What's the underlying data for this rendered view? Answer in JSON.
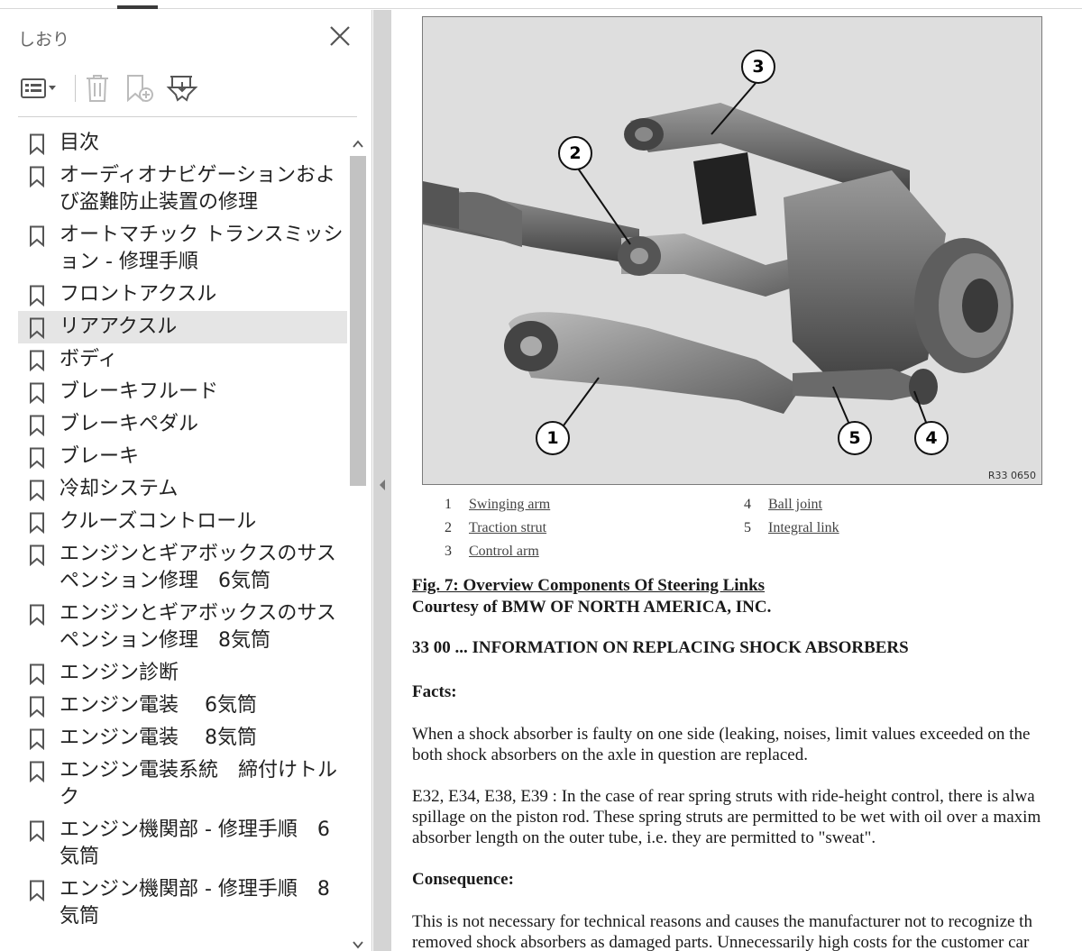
{
  "sidebar": {
    "title": "しおり",
    "close_icon": "close-icon",
    "toolbar": [
      {
        "name": "bookmark-options-menu",
        "icon": "list-options-icon"
      },
      {
        "name": "delete-bookmark-button",
        "icon": "trash-icon"
      },
      {
        "name": "add-bookmark-button",
        "icon": "bookmark-add-icon"
      },
      {
        "name": "expand-bookmark-button",
        "icon": "bookmark-expand-icon"
      }
    ],
    "bookmarks": [
      "目次",
      "オーディオナビゲーションおよび盗難防止装置の修理",
      "オートマチック トランスミッション - 修理手順",
      "フロントアクスル",
      "リアアクスル",
      "ボディ",
      "ブレーキフルード",
      "ブレーキペダル",
      "ブレーキ",
      "冷却システム",
      "クルーズコントロール",
      "エンジンとギアボックスのサスペンション修理　6気筒",
      "エンジンとギアボックスのサスペンション修理　8気筒",
      "エンジン診断",
      "エンジン電装　 6気筒",
      "エンジン電装　 8気筒",
      "エンジン電装系統　締付けトルク",
      "エンジン機関部 - 修理手順　6気筒",
      "エンジン機関部 - 修理手順　8気筒"
    ],
    "selected_index": 4
  },
  "document": {
    "figure_code": "R33 0650",
    "callouts": [
      "1",
      "2",
      "3",
      "4",
      "5"
    ],
    "legend": [
      {
        "num": "1",
        "label": "Swinging arm"
      },
      {
        "num": "2",
        "label": "Traction strut"
      },
      {
        "num": "3",
        "label": "Control arm"
      },
      {
        "num": "4",
        "label": "Ball joint"
      },
      {
        "num": "5",
        "label": "Integral link"
      }
    ],
    "caption": "Fig. 7: Overview Components Of Steering Links",
    "courtesy": "Courtesy of BMW OF NORTH AMERICA, INC.",
    "heading": "33 00 ... INFORMATION ON REPLACING SHOCK ABSORBERS",
    "facts_heading": "Facts:",
    "para1_line1": "When a shock absorber is faulty on one side (leaking, noises, limit values exceeded on the",
    "para1_line2": "both shock absorbers on the axle in question are replaced.",
    "para2_line1": "E32, E34, E38, E39 : In the case of rear spring struts with ride-height control, there is alwa",
    "para2_line2": "spillage on the piston rod. These spring struts are permitted to be wet with oil over a maxim",
    "para2_line3": "absorber length on the outer tube, i.e. they are permitted to \"sweat\".",
    "consequence_heading": "Consequence:",
    "para3_line1": "This is not necessary for technical reasons and causes the manufacturer not to recognize th",
    "para3_line2": "removed shock absorbers as damaged parts. Unnecessarily high costs for the customer car"
  },
  "colors": {
    "sidebar_selected": "#e5e5e5",
    "splitter": "#d4d4d4",
    "scroll_thumb": "#c2c2c2"
  }
}
